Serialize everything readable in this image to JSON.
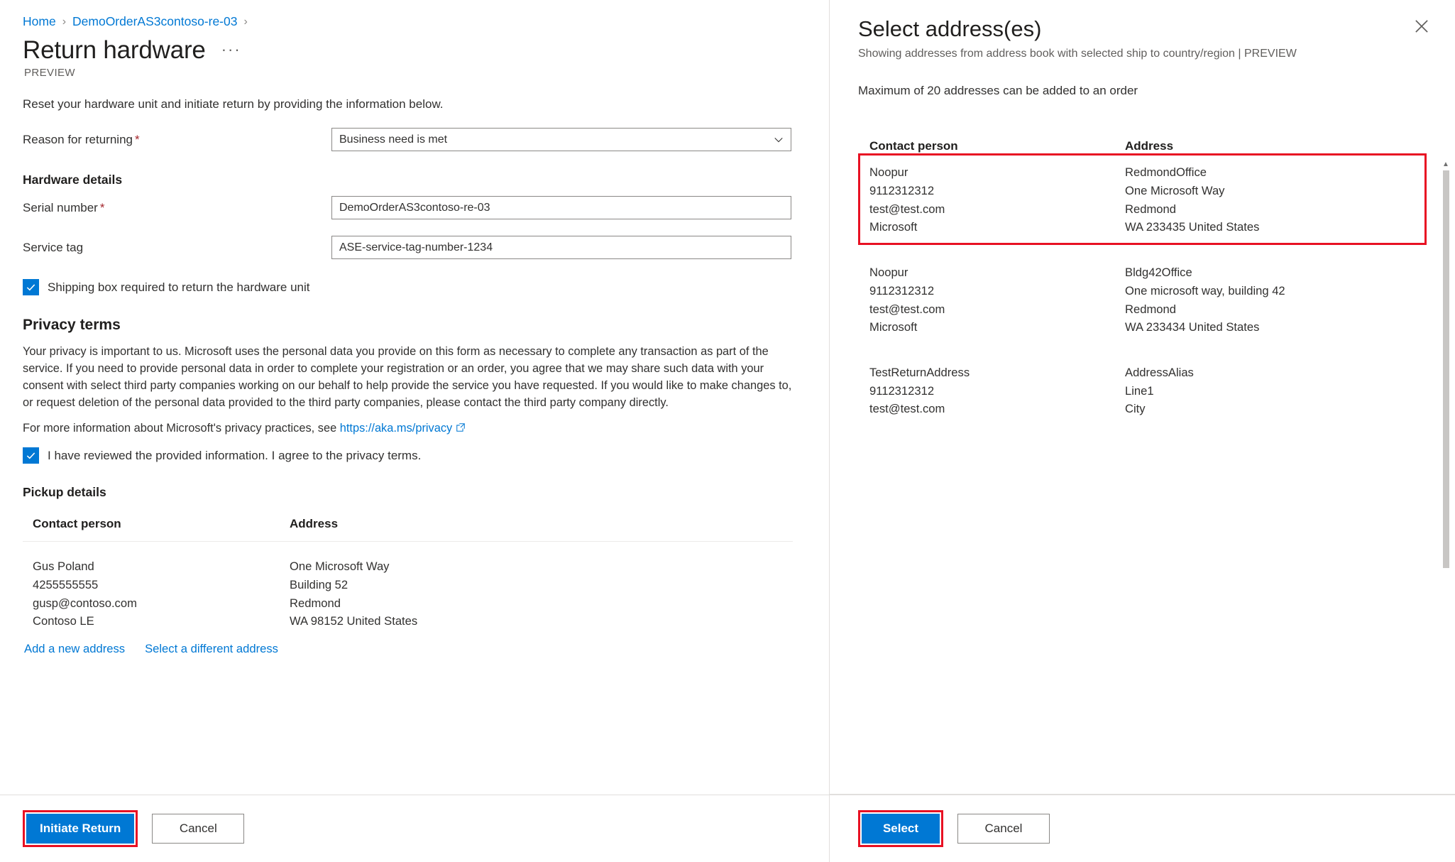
{
  "breadcrumb": {
    "home": "Home",
    "order": "DemoOrderAS3contoso-re-03",
    "separator": "›"
  },
  "left": {
    "title": "Return hardware",
    "ellipsis": "···",
    "preview_tag": "PREVIEW",
    "intro": "Reset your hardware unit and initiate return by providing the information below.",
    "reason_label": "Reason for returning",
    "reason_value": "Business need is met",
    "required_marker": "*",
    "hardware_details_heading": "Hardware details",
    "serial_label": "Serial number",
    "serial_value": "DemoOrderAS3contoso-re-03",
    "service_tag_label": "Service tag",
    "service_tag_value": "ASE-service-tag-number-1234",
    "shipping_box_label": "Shipping box required to return the hardware unit",
    "privacy_heading": "Privacy terms",
    "privacy_paragraph": "Your privacy is important to us. Microsoft uses the personal data you provide on this form as necessary to complete any transaction as part of the service. If you need to provide personal data in order to complete your registration or an order, you agree that we may share such data with your consent with select third party companies working on our behalf to help provide the service you have requested. If you would like to make changes to, or request deletion of the personal data provided to the third party companies, please contact the third party company directly.",
    "privacy_link_prefix": "For more information about Microsoft's privacy practices, see ",
    "privacy_link_text": "https://aka.ms/privacy",
    "privacy_agree_label": "I have reviewed the provided information. I agree to the privacy terms.",
    "pickup_heading": "Pickup details",
    "table_headers": {
      "contact": "Contact person",
      "address": "Address"
    },
    "pickup_row": {
      "contact": [
        "Gus Poland",
        "4255555555",
        "gusp@contoso.com",
        "Contoso LE"
      ],
      "address": [
        "One Microsoft Way",
        "Building 52",
        "Redmond",
        "WA 98152 United States"
      ]
    },
    "add_new_address": "Add a new address",
    "select_different_address": "Select a different address",
    "footer": {
      "primary": "Initiate Return",
      "cancel": "Cancel"
    }
  },
  "right": {
    "title": "Select address(es)",
    "subtitle": "Showing addresses from address book with selected ship to country/region | PREVIEW",
    "note": "Maximum of 20 addresses can be added to an order",
    "table_headers": {
      "contact": "Contact person",
      "address": "Address"
    },
    "rows": [
      {
        "selected": true,
        "contact": [
          "Noopur",
          "9112312312",
          "test@test.com",
          "Microsoft"
        ],
        "address": [
          "RedmondOffice",
          "One Microsoft Way",
          "Redmond",
          "WA 233435 United States"
        ]
      },
      {
        "selected": false,
        "contact": [
          "Noopur",
          "9112312312",
          "test@test.com",
          "Microsoft"
        ],
        "address": [
          "Bldg42Office",
          "One microsoft way, building 42",
          "Redmond",
          "WA 233434 United States"
        ]
      },
      {
        "selected": false,
        "contact": [
          "TestReturnAddress",
          "9112312312",
          "test@test.com"
        ],
        "address": [
          "AddressAlias",
          "Line1",
          "City"
        ]
      }
    ],
    "footer": {
      "primary": "Select",
      "cancel": "Cancel"
    }
  },
  "colors": {
    "accent": "#0078d4",
    "highlight": "#e81123",
    "required": "#a4262c",
    "border": "#8a8886"
  }
}
